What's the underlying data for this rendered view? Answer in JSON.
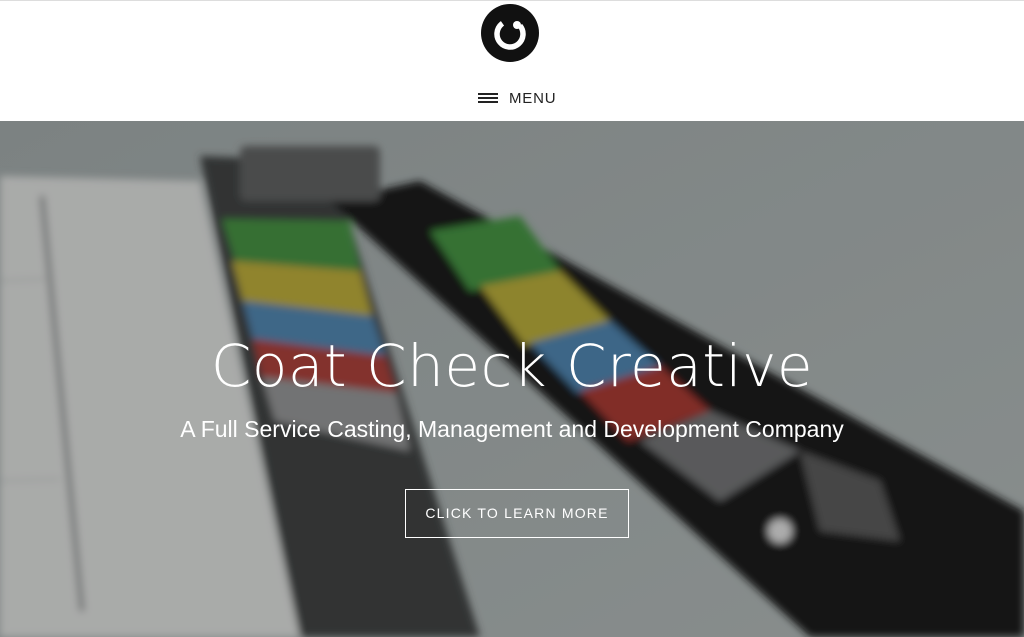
{
  "header": {
    "logo_icon": "coat-check-logo-icon",
    "menu_icon": "hamburger-menu-icon",
    "menu_label": "MENU"
  },
  "hero": {
    "background": "blurred-film-clapperboard-image",
    "title": "Coat Check Creative",
    "subtitle": "A Full Service Casting, Management and Development Company",
    "button_label": "CLICK TO LEARN MORE"
  },
  "colors": {
    "header_bg": "#ffffff",
    "logo_bg": "#111111",
    "hero_text": "#ffffff"
  }
}
